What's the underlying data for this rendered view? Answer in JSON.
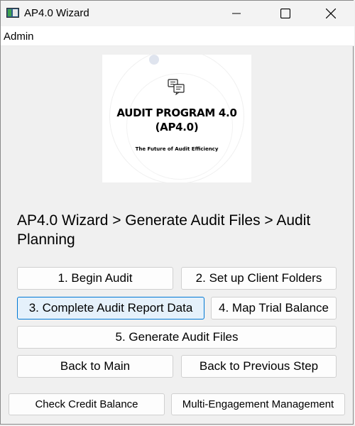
{
  "window": {
    "title": "AP4.0 Wizard",
    "controls": {
      "minimize": "minimize",
      "maximize": "maximize",
      "close": "close"
    }
  },
  "menu": {
    "items": [
      {
        "label": "Admin"
      }
    ]
  },
  "logo": {
    "icon": "chat-document-icon",
    "title_line1": "AUDIT PROGRAM 4.0",
    "title_line2": "(AP4.0)",
    "tagline": "The Future of Audit Efficiency"
  },
  "breadcrumb": "AP4.0 Wizard > Generate Audit Files > Audit Planning",
  "buttons": {
    "begin_audit": "1. Begin Audit",
    "setup_client_folders": "2. Set up Client Folders",
    "complete_audit_report_data": "3. Complete Audit Report Data",
    "map_trial_balance": "4. Map Trial Balance",
    "generate_audit_files": "5. Generate Audit Files",
    "back_to_main": "Back to Main",
    "back_to_previous_step": "Back to Previous Step",
    "check_credit_balance": "Check Credit Balance",
    "multi_engagement_management": "Multi-Engagement Management"
  },
  "colors": {
    "focus_border": "#0078d4",
    "focus_fill": "#e5f1fb"
  }
}
